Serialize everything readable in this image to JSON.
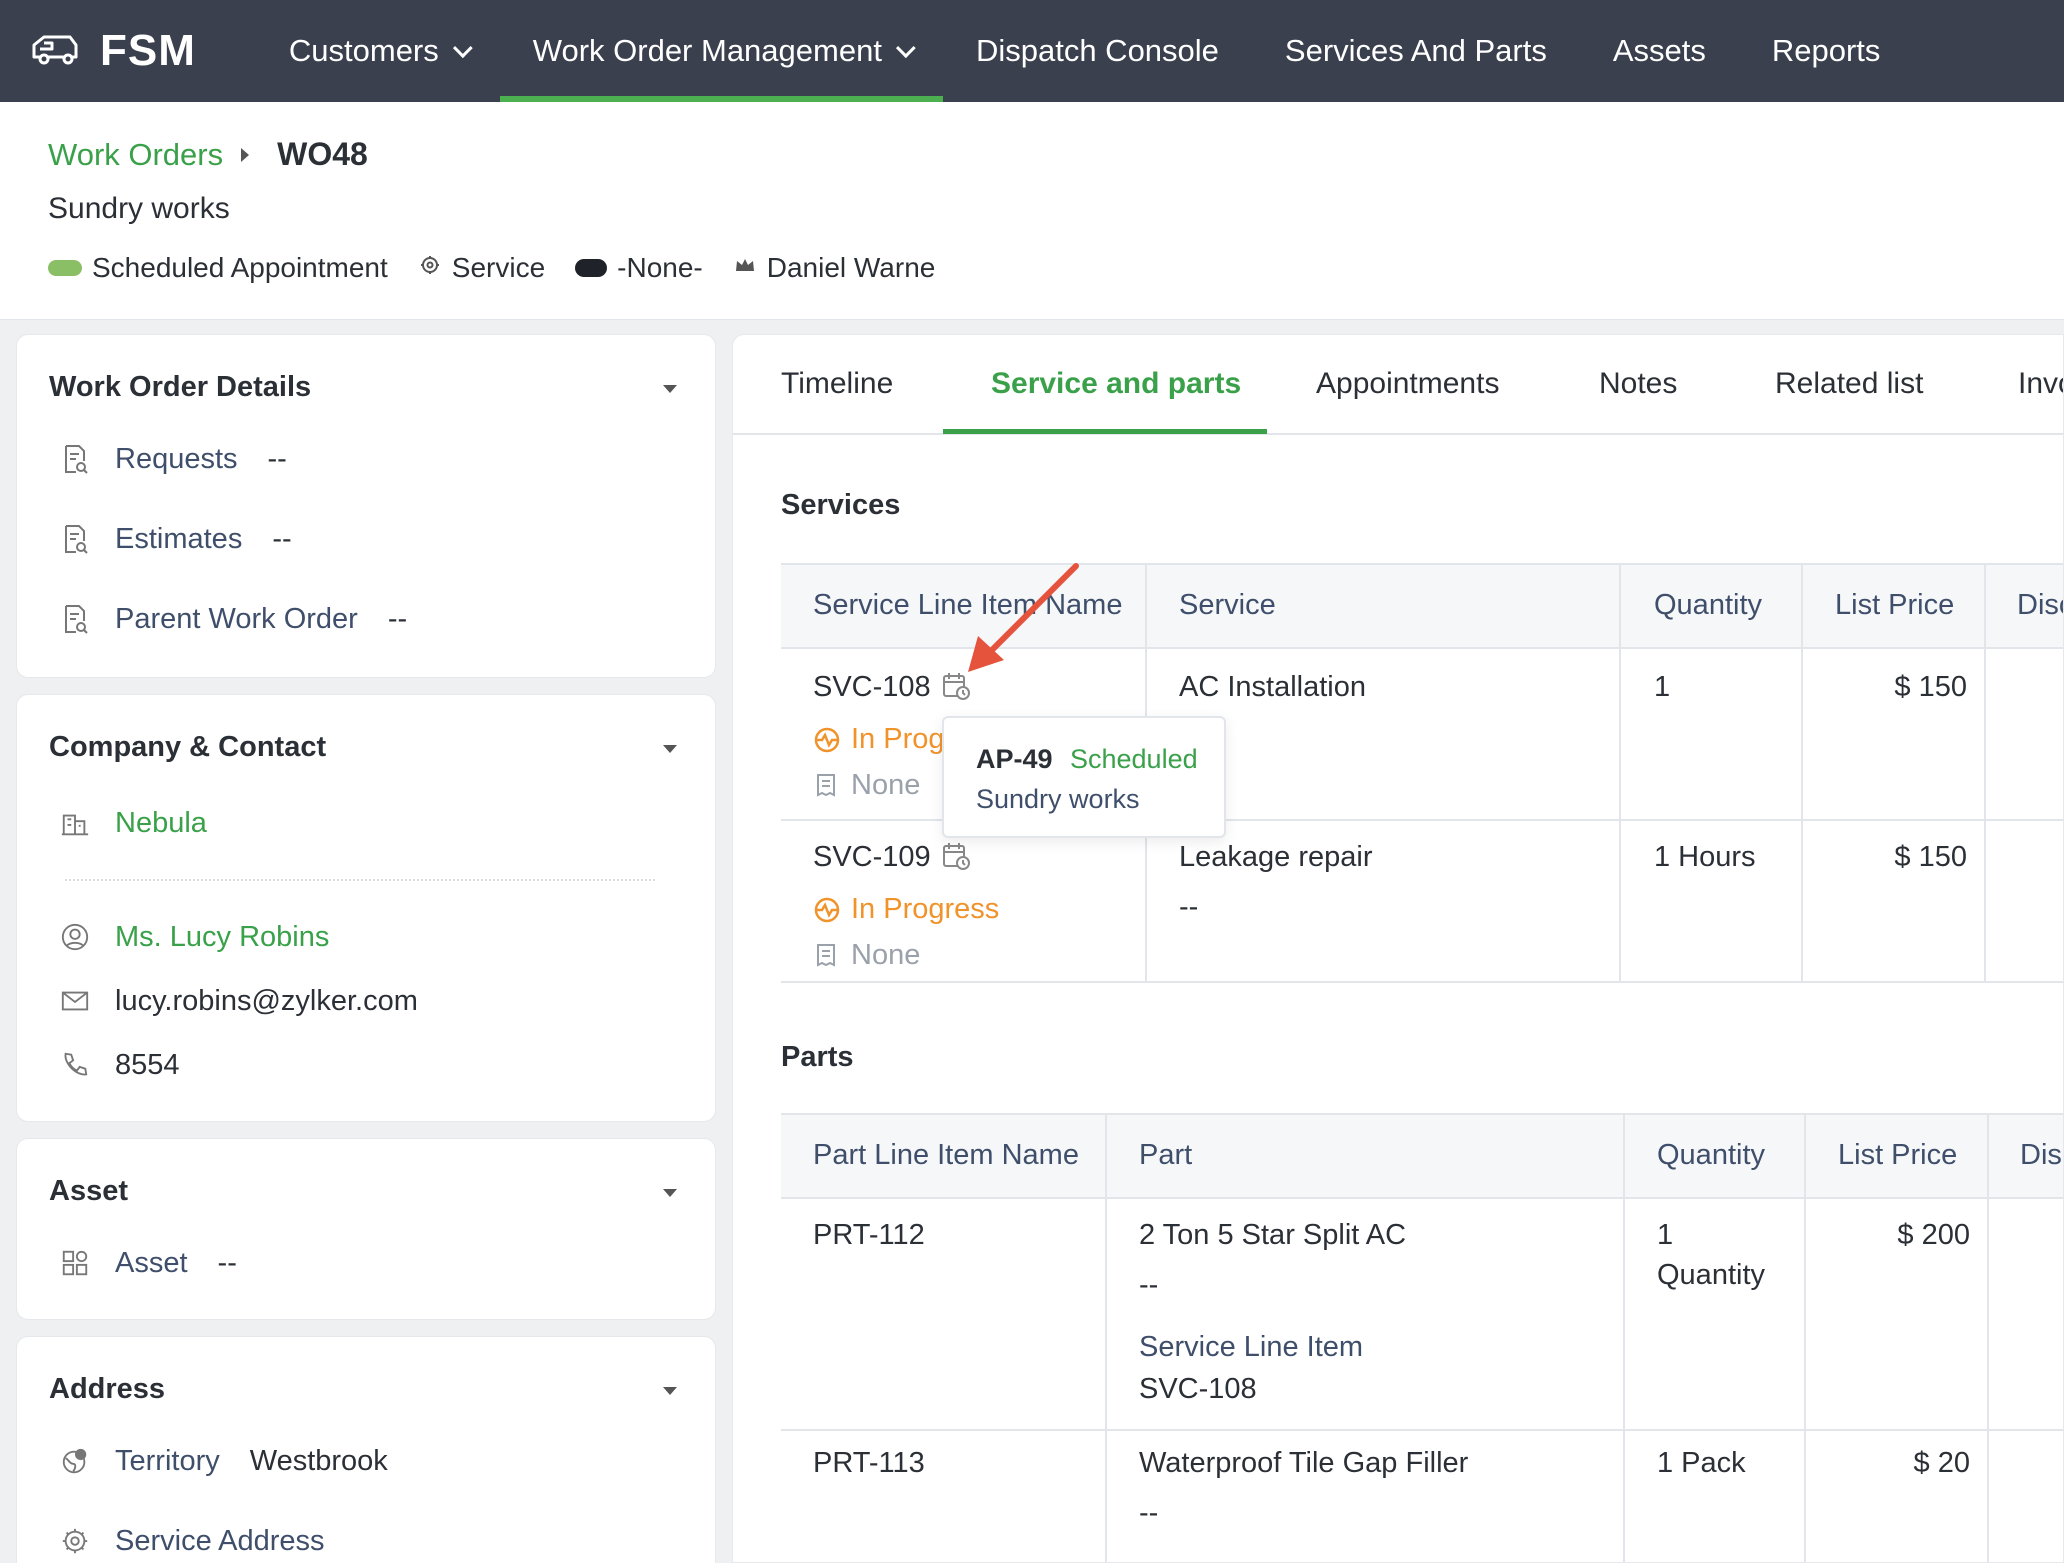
{
  "nav": {
    "brand": "FSM",
    "items": [
      {
        "label": "Customers",
        "dropdown": true
      },
      {
        "label": "Work Order Management",
        "dropdown": true,
        "active": true
      },
      {
        "label": "Dispatch Console"
      },
      {
        "label": "Services And Parts"
      },
      {
        "label": "Assets"
      },
      {
        "label": "Reports"
      }
    ]
  },
  "breadcrumb": {
    "parent": "Work Orders",
    "current": "WO48"
  },
  "work_order": {
    "title": "Sundry works",
    "status": "Scheduled Appointment",
    "type": "Service",
    "priority": "-None-",
    "owner": "Daniel Warne"
  },
  "details_panel": {
    "title": "Work Order Details",
    "rows": [
      {
        "icon": "document-search-icon",
        "label": "Requests",
        "value": "--"
      },
      {
        "icon": "document-search-icon",
        "label": "Estimates",
        "value": "--"
      },
      {
        "icon": "document-search-icon",
        "label": "Parent Work Order",
        "value": "--"
      }
    ]
  },
  "company_panel": {
    "title": "Company & Contact",
    "company": "Nebula",
    "contact": "Ms. Lucy Robins",
    "email": "lucy.robins@zylker.com",
    "phone": "8554"
  },
  "asset_panel": {
    "title": "Asset",
    "label": "Asset",
    "value": "--"
  },
  "address_panel": {
    "title": "Address",
    "territory_label": "Territory",
    "territory_value": "Westbrook",
    "service_address_label": "Service Address"
  },
  "tabs": [
    "Timeline",
    "Service and parts",
    "Appointments",
    "Notes",
    "Related list",
    "Invo"
  ],
  "active_tab": "Service and parts",
  "services": {
    "title": "Services",
    "columns": [
      "Service Line Item Name",
      "Service",
      "Quantity",
      "List Price",
      "Disc"
    ],
    "rows": [
      {
        "name": "SVC-108",
        "status": "In Progr",
        "sub": "None",
        "service": "AC Installation",
        "service_desc": "",
        "quantity": "1",
        "price": "$ 150"
      },
      {
        "name": "SVC-109",
        "status": "In Progress",
        "sub": "None",
        "service": "Leakage repair",
        "service_desc": "--",
        "quantity": "1 Hours",
        "price": "$ 150"
      }
    ]
  },
  "tooltip": {
    "id": "AP-49",
    "status": "Scheduled",
    "subtitle": "Sundry works"
  },
  "parts": {
    "title": "Parts",
    "columns": [
      "Part Line Item Name",
      "Part",
      "Quantity",
      "List Price",
      "Dis"
    ],
    "rows": [
      {
        "name": "PRT-112",
        "part": "2 Ton 5 Star Split AC",
        "part_desc": "--",
        "link_label": "Service Line Item",
        "link_value": "SVC-108",
        "quantity": "1",
        "quantity_unit": "Quantity",
        "price": "$ 200"
      },
      {
        "name": "PRT-113",
        "part": "Waterproof Tile Gap Filler",
        "part_desc": "--",
        "quantity": "1 Pack",
        "price": "$ 20"
      }
    ]
  },
  "colors": {
    "nav_bg": "#3a404d",
    "accent_green": "#3aa14a",
    "in_progress": "#f0932b",
    "annotation_arrow": "#e5533d"
  }
}
